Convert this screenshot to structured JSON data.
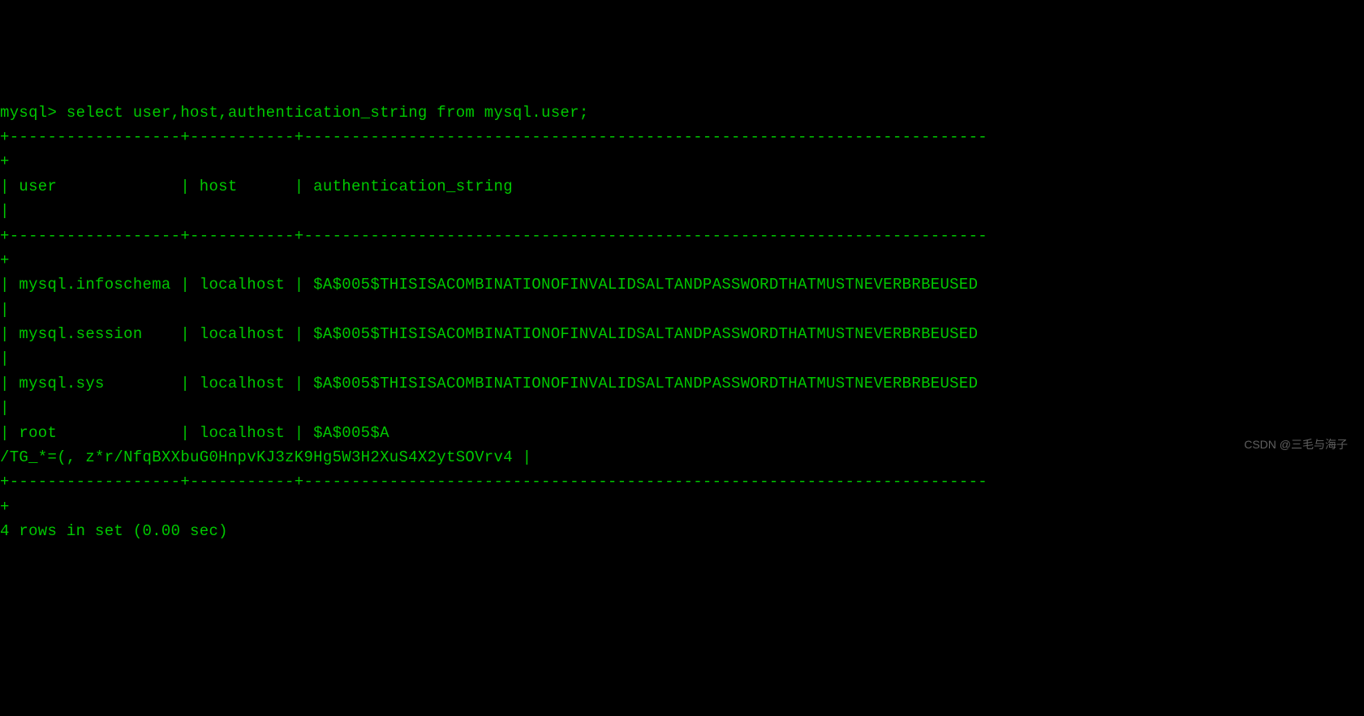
{
  "terminal": {
    "prompt": "mysql> ",
    "query": "select user,host,authentication_string from mysql.user;",
    "border_top": "+------------------+-----------+------------------------------------------------------------------------",
    "border_plus": "+",
    "header_row": "| user             | host      | authentication_string                                                    ",
    "header_pipe": "|",
    "border_mid": "+------------------+-----------+------------------------------------------------------------------------",
    "rows": [
      {
        "line1": "| mysql.infoschema | localhost | $A$005$THISISACOMBINATIONOFINVALIDSALTANDPASSWORDTHATMUSTNEVERBRBEUSED ",
        "line2": "|"
      },
      {
        "line1": "| mysql.session    | localhost | $A$005$THISISACOMBINATIONOFINVALIDSALTANDPASSWORDTHATMUSTNEVERBRBEUSED ",
        "line2": "|"
      },
      {
        "line1": "| mysql.sys        | localhost | $A$005$THISISACOMBINATIONOFINVALIDSALTANDPASSWORDTHATMUSTNEVERBRBEUSED ",
        "line2": "|"
      },
      {
        "line1": "| root             | localhost | $A$005$A",
        "line2": "/TG_*=(, z*r/NfqBXXbuG0HnpvKJ3zK9Hg5W3H2XuS4X2ytSOVrv4 |"
      }
    ],
    "border_bottom": "+------------------+-----------+------------------------------------------------------------------------",
    "status": "4 rows in set (0.00 sec)"
  },
  "watermark": "CSDN @三毛与海子",
  "table_data": {
    "columns": [
      "user",
      "host",
      "authentication_string"
    ],
    "rows": [
      {
        "user": "mysql.infoschema",
        "host": "localhost",
        "authentication_string": "$A$005$THISISACOMBINATIONOFINVALIDSALTANDPASSWORDTHATMUSTNEVERBRBEUSED"
      },
      {
        "user": "mysql.session",
        "host": "localhost",
        "authentication_string": "$A$005$THISISACOMBINATIONOFINVALIDSALTANDPASSWORDTHATMUSTNEVERBRBEUSED"
      },
      {
        "user": "mysql.sys",
        "host": "localhost",
        "authentication_string": "$A$005$THISISACOMBINATIONOFINVALIDSALTANDPASSWORDTHATMUSTNEVERBRBEUSED"
      },
      {
        "user": "root",
        "host": "localhost",
        "authentication_string": "$A$005$A\n/TG_*=(, z*r/NfqBXXbuG0HnpvKJ3zK9Hg5W3H2XuS4X2ytSOVrv4"
      }
    ]
  }
}
